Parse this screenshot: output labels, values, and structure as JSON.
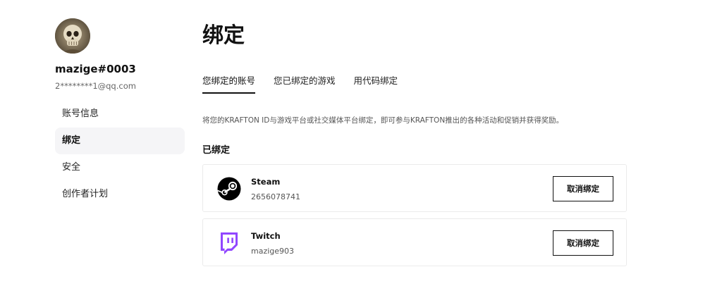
{
  "user": {
    "username": "mazige#0003",
    "email": "2********1@qq.com"
  },
  "sidebar": {
    "items": [
      {
        "label": "账号信息",
        "active": false
      },
      {
        "label": "绑定",
        "active": true
      },
      {
        "label": "安全",
        "active": false
      },
      {
        "label": "创作者计划",
        "active": false
      }
    ]
  },
  "main": {
    "title": "绑定",
    "tabs": [
      {
        "label": "您绑定的账号",
        "active": true
      },
      {
        "label": "您已绑定的游戏",
        "active": false
      },
      {
        "label": "用代码绑定",
        "active": false
      }
    ],
    "description": "将您的KRAFTON ID与游戏平台或社交媒体平台绑定，即可参与KRAFTON推出的各种活动和促销并获得奖励。",
    "section_title": "已绑定",
    "accounts": [
      {
        "platform": "Steam",
        "account_id": "2656078741",
        "button_label": "取消绑定",
        "icon": "steam-icon",
        "color": "#000000"
      },
      {
        "platform": "Twitch",
        "account_id": "mazige903",
        "button_label": "取消绑定",
        "icon": "twitch-icon",
        "color": "#9146ff"
      }
    ]
  }
}
